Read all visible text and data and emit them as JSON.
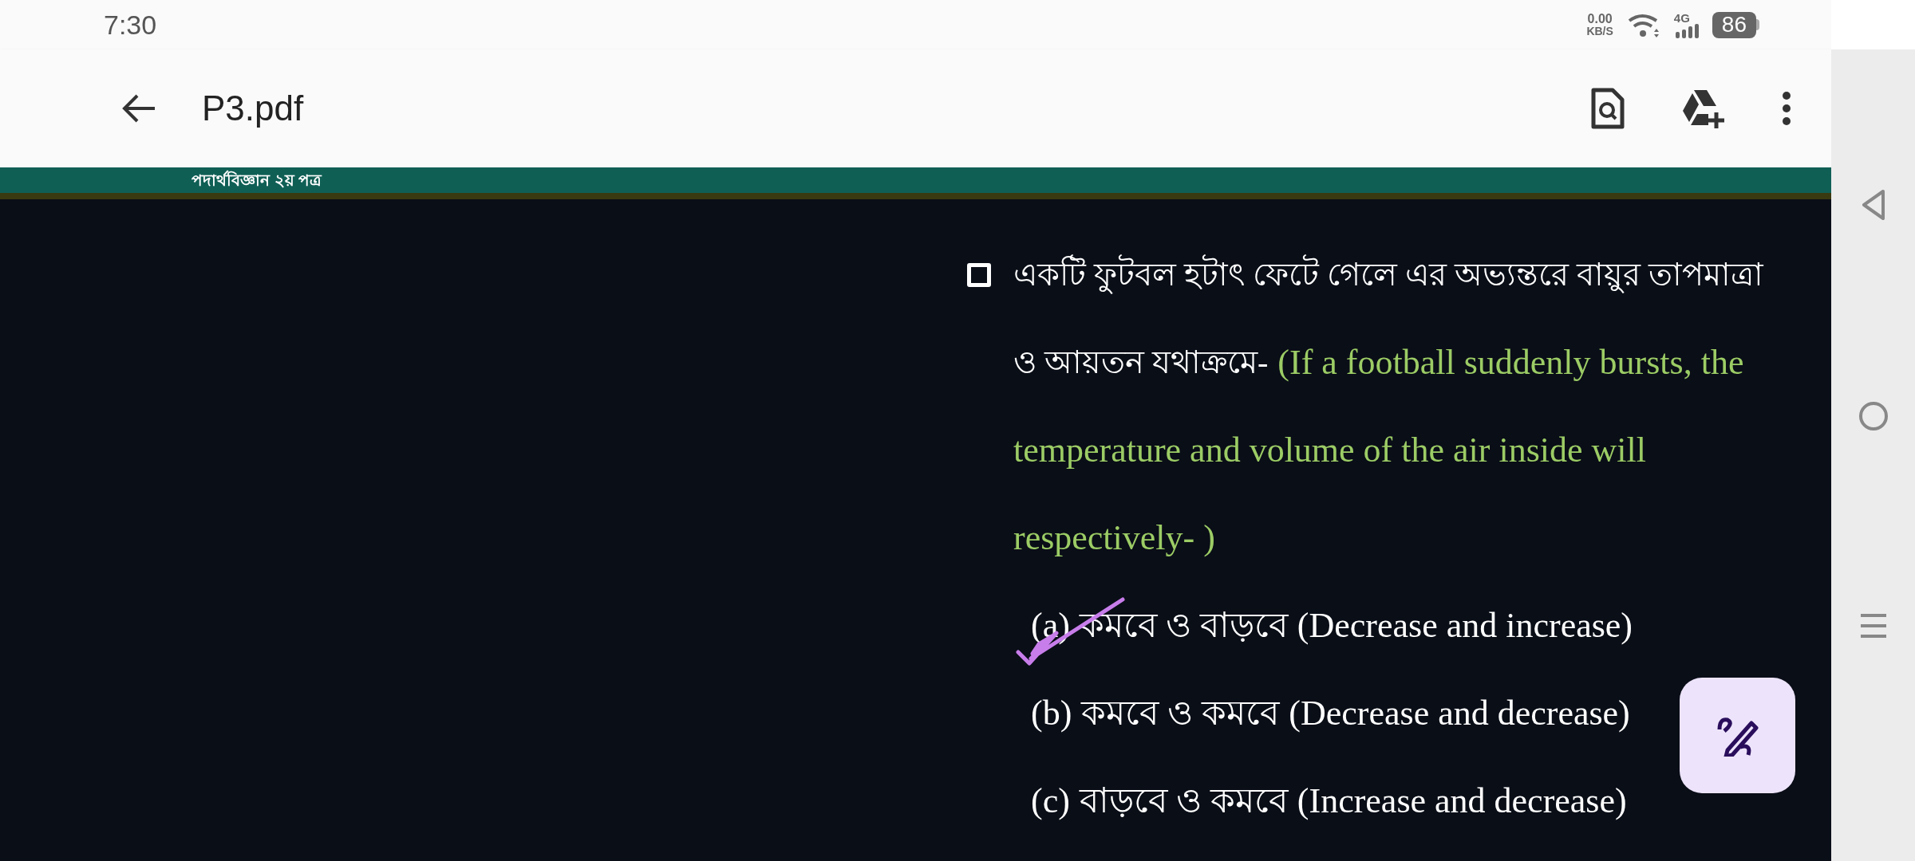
{
  "status_bar": {
    "time": "7:30",
    "net_speed_value": "0.00",
    "net_speed_unit": "KB/S",
    "network": "4G",
    "battery": "86"
  },
  "app_bar": {
    "title": "P3.pdf"
  },
  "banner": {
    "title": "পদার্থবিজ্ঞান ২য় পত্র"
  },
  "question": {
    "lines": [
      {
        "bengali": "একটি ফুটবল হটাৎ ফেটে গেলে এর অভ্যন্তরে বায়ুর তাপমাত্রা"
      },
      {
        "bengali": "ও আয়তন যথাক্রমে-",
        "english": "(If a football suddenly bursts, the"
      },
      {
        "english": "temperature and volume of the air inside will"
      },
      {
        "english": "respectively- )"
      }
    ]
  },
  "options": [
    {
      "label": "(a)",
      "bengali": "কমবে ও বাড়বে",
      "english": "(Decrease and increase)",
      "marked": true
    },
    {
      "label": "(b)",
      "bengali": "কমবে ও কমবে",
      "english": "(Decrease and decrease)",
      "marked": false
    },
    {
      "label": "(c)",
      "bengali": "বাড়বে ও কমবে",
      "english": "(Increase and decrease)",
      "marked": false
    }
  ]
}
